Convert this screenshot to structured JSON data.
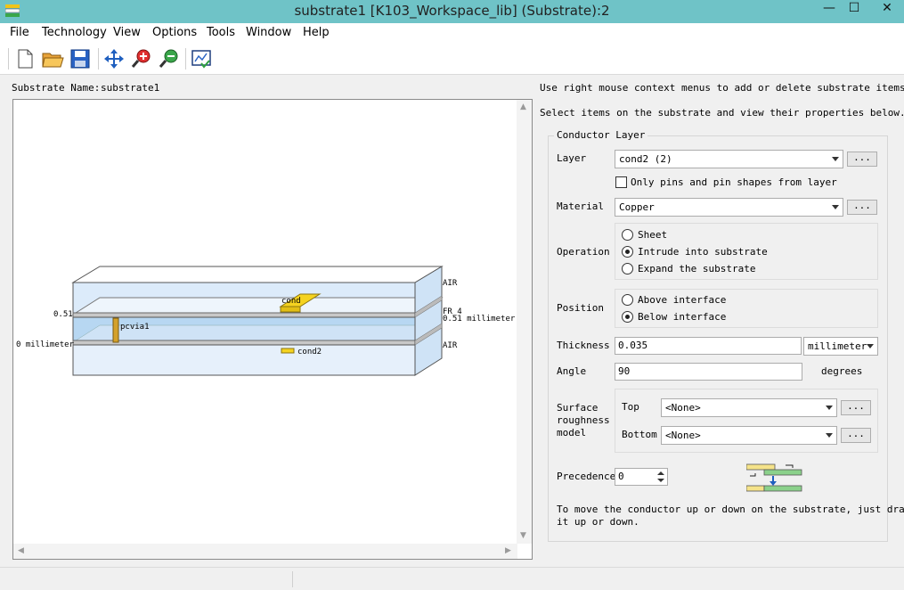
{
  "window": {
    "title": "substrate1 [K103_Workspace_lib] (Substrate):2",
    "controls": {
      "minimize": "—",
      "maximize": "☐",
      "close": "✕"
    }
  },
  "menu": [
    "File",
    "Technology",
    "View",
    "Options",
    "Tools",
    "Window",
    "Help"
  ],
  "toolbar": {
    "icons": [
      "new-file-icon",
      "open-folder-icon",
      "save-icon",
      "pan-icon",
      "zoom-in-icon",
      "zoom-out-icon",
      "view-all-icon"
    ]
  },
  "substrate": {
    "name_label": "Substrate Name:",
    "name_value": "substrate1"
  },
  "diagram": {
    "layers": {
      "air_top": "AIR",
      "fr4": "FR_4",
      "fr4_thickness": "0.51 millimeter",
      "air_bottom": "AIR"
    },
    "interfaces": {
      "top": "0.51",
      "bottom": "0 millimeter"
    },
    "items": {
      "cond_top": "cond",
      "via": "pcvia1",
      "cond_bottom": "cond2"
    }
  },
  "instructions": {
    "line1": "Use right mouse context menus to add or delete substrate items.",
    "line2": "Select items on the substrate and view their properties below."
  },
  "conductor_layer": {
    "group_title": "Conductor Layer",
    "layer_label": "Layer",
    "layer_value": "cond2 (2)",
    "only_pins_label": "Only pins and pin shapes from layer",
    "material_label": "Material",
    "material_value": "Copper",
    "more_button": "...",
    "operation_label": "Operation",
    "operations": [
      "Sheet",
      "Intrude into substrate",
      "Expand the substrate"
    ],
    "operation_selected": 1,
    "position_label": "Position",
    "positions": [
      "Above interface",
      "Below interface"
    ],
    "position_selected": 1,
    "thickness_label": "Thickness",
    "thickness_value": "0.035",
    "thickness_unit": "millimeter",
    "angle_label": "Angle",
    "angle_value": "90",
    "angle_unit": "degrees",
    "roughness_label_1": "Surface",
    "roughness_label_2": "roughness",
    "roughness_label_3": "model",
    "top_label": "Top",
    "top_value": "<None>",
    "bottom_label": "Bottom",
    "bottom_value": "<None>",
    "precedence_label": "Precedence",
    "precedence_value": "0",
    "help_line1": "To move the conductor up or down on the substrate, just drag",
    "help_line2": "it up or down."
  },
  "colors": {
    "titlebar": "#6fc3c7",
    "substrate_fill": "#b7d7f2",
    "conductor": "#f5d320",
    "via": "#d4a12a"
  }
}
